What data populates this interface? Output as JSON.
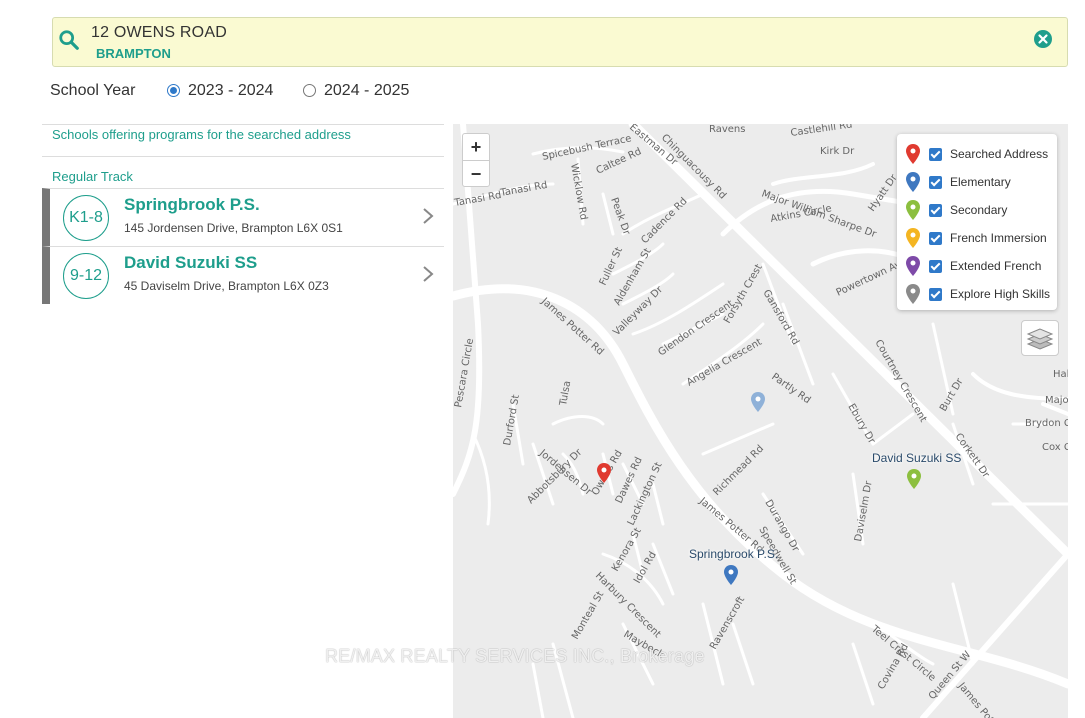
{
  "search": {
    "address_line1": "12 OWENS ROAD",
    "address_line2": "BRAMPTON"
  },
  "school_year": {
    "label": "School Year",
    "options": [
      {
        "label": "2023 - 2024",
        "selected": true
      },
      {
        "label": "2024 - 2025",
        "selected": false
      }
    ]
  },
  "panel": {
    "offering_text": "Schools offering programs for the searched address",
    "track_title": "Regular Track",
    "schools": [
      {
        "grades": "K1-8",
        "name": "Springbrook P.S.",
        "address": "145 Jordensen Drive, Brampton L6X 0S1"
      },
      {
        "grades": "9-12",
        "name": "David Suzuki SS",
        "address": "45 Daviselm Drive, Brampton L6X 0Z3"
      }
    ]
  },
  "map": {
    "zoom_in": "+",
    "zoom_out": "−",
    "legend": [
      {
        "label": "Searched Address",
        "color": "#e03a30",
        "checked": true
      },
      {
        "label": "Elementary",
        "color": "#3f78c0",
        "checked": true
      },
      {
        "label": "Secondary",
        "color": "#8cbf3f",
        "checked": true
      },
      {
        "label": "French Immersion",
        "color": "#f4b522",
        "checked": true
      },
      {
        "label": "Extended French",
        "color": "#7e4aa8",
        "checked": true
      },
      {
        "label": "Explore High Skills",
        "color": "#8a8a8a",
        "checked": true
      }
    ],
    "marker_labels": {
      "david_suzuki": "David Suzuki SS",
      "springbrook": "Springbrook P.S."
    },
    "streets": [
      "Ravens",
      "Castlehill Rd",
      "Kirk Dr",
      "Spicebush Terrace",
      "Eastman Dr",
      "Chinguacousy Rd",
      "Tanasi Rd",
      "Caltee Rd",
      "Wicklow Rd",
      "Major William Sharpe Dr",
      "Hyatt Dr",
      "Atkins Circle",
      "Peak Dr",
      "Cadence Rd",
      "Fuller St",
      "Aldenham St",
      "Powertown Ave",
      "Valleyway Dr",
      "Forsyth Crest",
      "Gansford Rd",
      "Glendon Crescent",
      "Angelia Crescent",
      "Partly Rd",
      "Ebury Dr",
      "James Potter Rd",
      "Durford St",
      "Jordensen Dr",
      "Owens Rd",
      "Dawes Rd",
      "Lackington St",
      "Abbotsbury Dr",
      "Richmead Rd",
      "Durango Dr",
      "Daviselm Dr",
      "Speedwell St",
      "Kenora St",
      "Idol Rd",
      "Harbury Crescent",
      "Maybeck",
      "Ravenscroft",
      "Teel Crest Circle",
      "Covina Rd",
      "Queen St W",
      "Burt Dr",
      "Corkett Dr",
      "Brydon Cres",
      "Cox Cr",
      "Major",
      "Hal",
      "Monteal St",
      "Courtney Crescent"
    ],
    "watermark": "RE/MAX REALTY SERVICES INC., Brokerage"
  },
  "colors": {
    "accent": "#1e9e8c",
    "search_bg": "#fafad2",
    "radio_blue": "#2f79c9",
    "map_bg": "#ececec"
  }
}
